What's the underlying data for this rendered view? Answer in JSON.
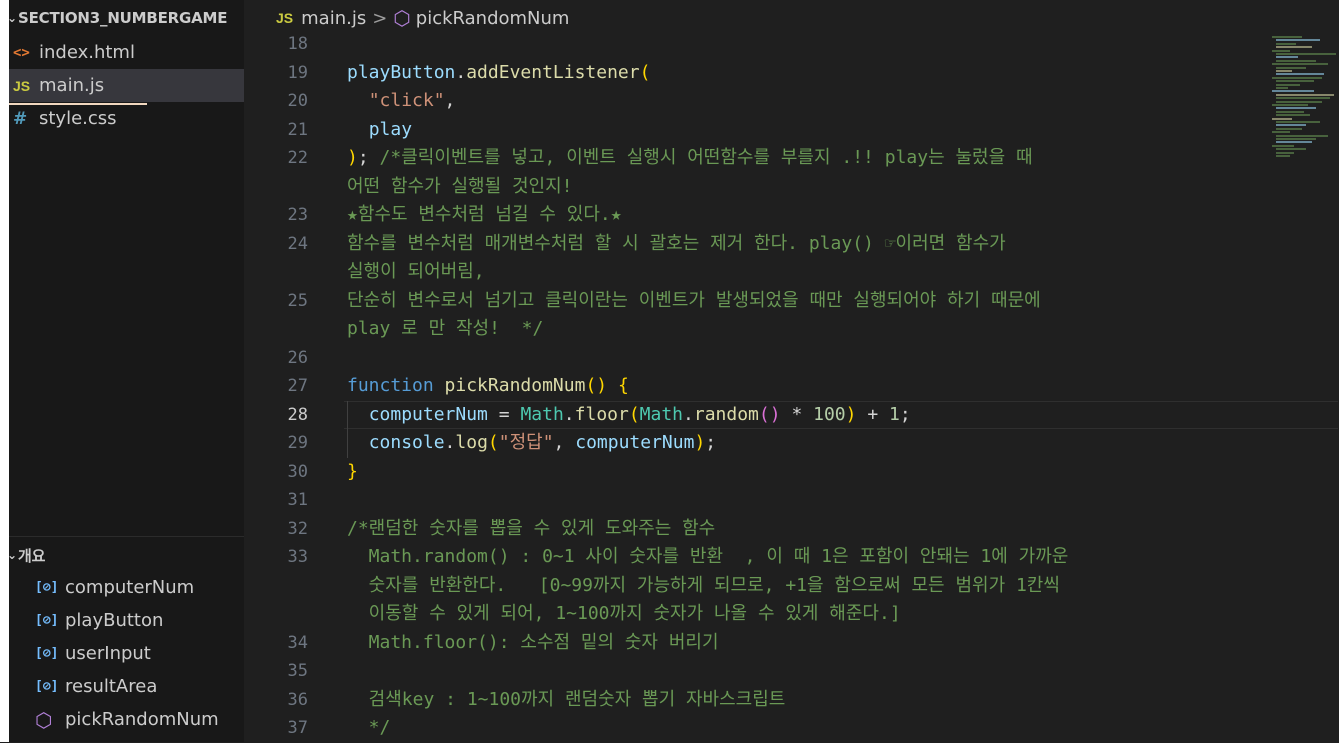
{
  "sidebar": {
    "folder_name": "SECTION3_NUMBERGAME",
    "files": [
      {
        "name": "index.html",
        "icon": "<>",
        "type": "html"
      },
      {
        "name": "main.js",
        "icon": "JS",
        "type": "js"
      },
      {
        "name": "style.css",
        "icon": "#",
        "type": "css"
      }
    ],
    "active_file": "main.js",
    "outline_title": "개요",
    "outline_items": [
      {
        "name": "computerNum",
        "icon": "[⊘]",
        "kind": "variable"
      },
      {
        "name": "playButton",
        "icon": "[⊘]",
        "kind": "variable"
      },
      {
        "name": "userInput",
        "icon": "[⊘]",
        "kind": "variable"
      },
      {
        "name": "resultArea",
        "icon": "[⊘]",
        "kind": "variable"
      },
      {
        "name": "pickRandomNum",
        "icon": "⬡",
        "kind": "function"
      }
    ]
  },
  "breadcrumb": {
    "file_icon": "JS",
    "file": "main.js",
    "separator": ">",
    "symbol_icon": "⬡",
    "symbol": "pickRandomNum"
  },
  "editor": {
    "current_line": "28",
    "lines": [
      {
        "num": "18",
        "text": ""
      },
      {
        "num": "19",
        "text": "playButton.addEventListener("
      },
      {
        "num": "20",
        "text": "  \"click\","
      },
      {
        "num": "21",
        "text": "  play"
      },
      {
        "num": "22",
        "text": "); /*클릭이벤트를 넣고, 이벤트 실행시 어떤함수를 부를지 .!! play는 눌렀을 때"
      },
      {
        "num": "",
        "text": "어떤 함수가 실행될 것인지!"
      },
      {
        "num": "23",
        "text": "★함수도 변수처럼 넘길 수 있다.★"
      },
      {
        "num": "24",
        "text": "함수를 변수처럼 매개변수처럼 할 시 괄호는 제거 한다. play() ☞이러면 함수가"
      },
      {
        "num": "",
        "text": "실행이 되어버림,"
      },
      {
        "num": "25",
        "text": "단순히 변수로서 넘기고 클릭이란는 이벤트가 발생되었을 때만 실행되어야 하기 때문에"
      },
      {
        "num": "",
        "text": "play 로 만 작성!  */"
      },
      {
        "num": "26",
        "text": ""
      },
      {
        "num": "27",
        "text": "function pickRandomNum() {"
      },
      {
        "num": "28",
        "text": "  computerNum = Math.floor(Math.random() * 100) + 1;"
      },
      {
        "num": "29",
        "text": "  console.log(\"정답\", computerNum);"
      },
      {
        "num": "30",
        "text": "}"
      },
      {
        "num": "31",
        "text": ""
      },
      {
        "num": "32",
        "text": "/*랜덤한 숫자를 뽑을 수 있게 도와주는 함수"
      },
      {
        "num": "33",
        "text": "  Math.random() : 0~1 사이 숫자를 반환  , 이 때 1은 포함이 안돼는 1에 가까운"
      },
      {
        "num": "",
        "text": "  숫자를 반환한다.   [0~99까지 가능하게 되므로, +1을 함으로써 모든 범위가 1칸씩"
      },
      {
        "num": "",
        "text": "  이동할 수 있게 되어, 1~100까지 숫자가 나올 수 있게 해준다.]"
      },
      {
        "num": "34",
        "text": "  Math.floor(): 소수점 밑의 숫자 버리기"
      },
      {
        "num": "35",
        "text": ""
      },
      {
        "num": "36",
        "text": "  검색key : 1~100까지 랜덤숫자 뽑기 자바스크립트"
      },
      {
        "num": "37",
        "text": "  */"
      }
    ]
  },
  "colors": {
    "background": "#1f1f1f",
    "sidebar": "#181818",
    "comment": "#6a9955",
    "keyword": "#569cd6",
    "function": "#dcdcaa",
    "variable": "#9cdcfe",
    "string": "#ce9178",
    "number": "#b5cea8"
  }
}
